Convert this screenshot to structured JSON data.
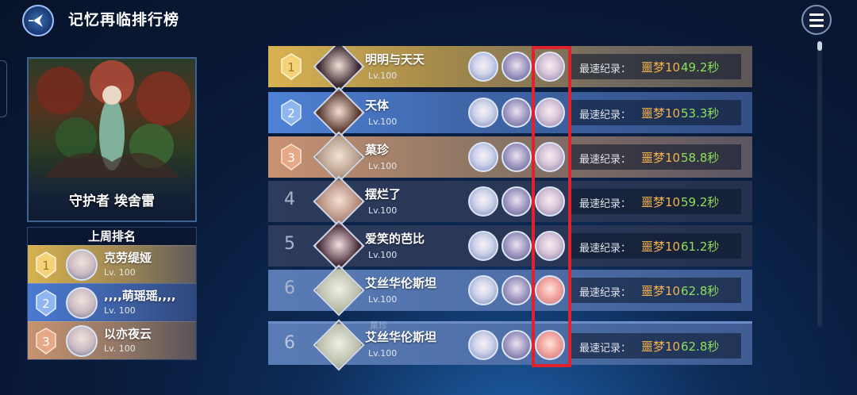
{
  "header": {
    "title": "记忆再临排行榜"
  },
  "boss": {
    "name": "守护者 埃舍雷"
  },
  "last_week": {
    "title": "上周排名",
    "entries": [
      {
        "rank": "1",
        "name": "克劳缇娅",
        "level": "Lv. 100"
      },
      {
        "rank": "2",
        "name": ",,,,萌瑶瑶,,,,",
        "level": "Lv. 100"
      },
      {
        "rank": "3",
        "name": "以亦夜云",
        "level": "Lv. 100"
      }
    ]
  },
  "ranking": {
    "rows": [
      {
        "rank": "1",
        "name": "明明与天天",
        "level": "Lv.100",
        "record_label": "最速纪录：",
        "difficulty": "噩梦10",
        "time": "49.2秒"
      },
      {
        "rank": "2",
        "name": "天体",
        "level": "Lv.100",
        "record_label": "最速纪录：",
        "difficulty": "噩梦10",
        "time": "53.3秒"
      },
      {
        "rank": "3",
        "name": "菓珍",
        "level": "Lv.100",
        "record_label": "最速纪录：",
        "difficulty": "噩梦10",
        "time": "58.8秒"
      },
      {
        "rank": "4",
        "name": "摆烂了",
        "level": "Lv.100",
        "record_label": "最速纪录：",
        "difficulty": "噩梦10",
        "time": "59.2秒"
      },
      {
        "rank": "5",
        "name": "爱笑的芭比",
        "level": "Lv.100",
        "record_label": "最速纪录：",
        "difficulty": "噩梦10",
        "time": "61.2秒"
      },
      {
        "rank": "6",
        "name": "艾丝华伦斯坦",
        "level": "Lv.100",
        "record_label": "最速纪录：",
        "difficulty": "噩梦10",
        "time": "62.8秒"
      }
    ],
    "self": {
      "rank": "6",
      "name": "艾丝华伦斯坦",
      "level": "Lv.100",
      "record_label": "最速记录：",
      "difficulty": "噩梦10",
      "time": "62.8秒",
      "peek_text": "菓珍"
    }
  },
  "colors": {
    "gold": "#d9b351",
    "blue": "#4e82d6",
    "bronze": "#c99272",
    "highlight": "#e0222c",
    "difficulty": "#f2b24b",
    "time": "#8ee05a"
  }
}
